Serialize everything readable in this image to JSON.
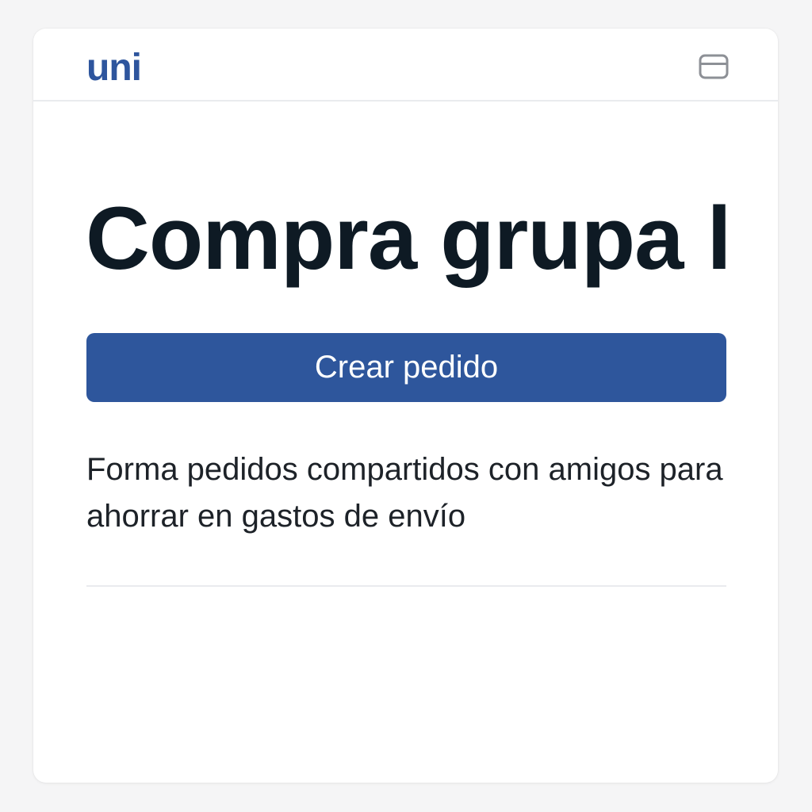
{
  "brand": {
    "logo_text": "uni",
    "color": "#2e559d"
  },
  "header": {
    "window_icon": "window-icon"
  },
  "main": {
    "title": "Compra grupa l",
    "title_color": "#0e1a24",
    "cta_label": "Crear pedido",
    "cta_color": "#2e569c",
    "description": "Forma pedidos compartidos con amigos para ahorrar en gastos de envío"
  }
}
